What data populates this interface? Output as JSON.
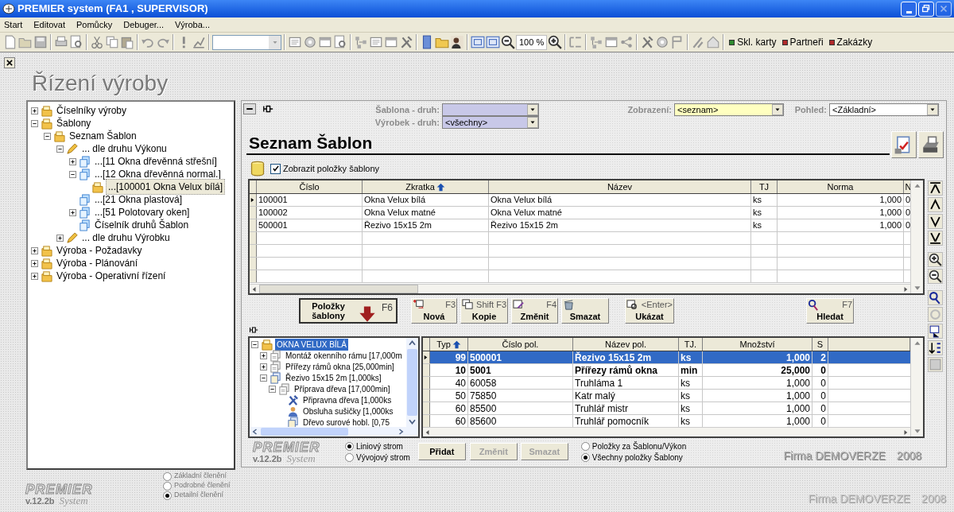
{
  "window": {
    "title": "PREMIER system (FA1 , SUPERVISOR)"
  },
  "menu": [
    "Start",
    "Editovat",
    "Pomůcky",
    "Debuger...",
    "Výroba..."
  ],
  "toolbar": {
    "zoom": "100 %",
    "quick_links": [
      {
        "label": "Skl. karty",
        "color": "#2f8a2f"
      },
      {
        "label": "Partneři",
        "color": "#b02a2a"
      },
      {
        "label": "Zakázky",
        "color": "#b02a2a"
      }
    ]
  },
  "page_title": "Řízení výroby",
  "nav_tree": [
    {
      "label": "Číselníky výroby",
      "kind": "folder",
      "expanded": false,
      "selected": false
    },
    {
      "label": "Šablony",
      "kind": "folder",
      "expanded": true,
      "selected": false,
      "children": [
        {
          "label": "Seznam Šablon",
          "kind": "folder",
          "expanded": true,
          "selected": false,
          "children": [
            {
              "label": "... dle druhu Výkonu",
              "kind": "pencil",
              "expanded": true,
              "selected": false,
              "children": [
                {
                  "label": "...[11 Okna dřevěnná střešní]",
                  "kind": "stack",
                  "expanded": false,
                  "selected": false
                },
                {
                  "label": "...[12 Okna dřevěnná normal.]",
                  "kind": "stack",
                  "expanded": true,
                  "selected": false,
                  "children": [
                    {
                      "label": "...[100001 Okna Velux bílá]",
                      "kind": "folder",
                      "selected": true
                    }
                  ]
                },
                {
                  "label": "...[21 Okna plastová]",
                  "kind": "stack",
                  "selected": false
                },
                {
                  "label": "...[51 Polotovary oken]",
                  "kind": "stack",
                  "expanded": false,
                  "selected": false
                },
                {
                  "label": "Číselník druhů Šablon",
                  "kind": "stack",
                  "selected": false
                }
              ]
            },
            {
              "label": "... dle druhu Výrobku",
              "kind": "pencil",
              "expanded": false,
              "selected": false
            }
          ]
        }
      ]
    },
    {
      "label": "Výroba - Požadavky",
      "kind": "folder",
      "expanded": false,
      "selected": false
    },
    {
      "label": "Výroba - Plánování",
      "kind": "folder",
      "expanded": false,
      "selected": false
    },
    {
      "label": "Výroba - Operativní řízení",
      "kind": "folder",
      "expanded": false,
      "selected": false
    }
  ],
  "filters": [
    {
      "label": "Šablona - druh:"
    },
    {
      "label": "Výrobek - druh:",
      "value": "<všechny>"
    }
  ],
  "display": {
    "label": "Zobrazení:",
    "value": "<seznam>"
  },
  "view": {
    "label": "Pohled:",
    "value": "<Základní>"
  },
  "section_title": "Seznam Šablon",
  "show_items": {
    "label": "Zobrazit položky šablony",
    "checked": true
  },
  "templates_table": {
    "columns": [
      {
        "label": "Číslo"
      },
      {
        "label": "Zkratka",
        "sorted": true
      },
      {
        "label": "Název"
      },
      {
        "label": "TJ"
      },
      {
        "label": "Norma",
        "kind": "number"
      },
      {
        "label": "N"
      }
    ],
    "rows": [
      {
        "selected": true,
        "cells": [
          "100001",
          "Okna Velux bílá",
          "Okna Velux bílá",
          "ks",
          "1,000",
          "0"
        ]
      },
      {
        "selected": false,
        "cells": [
          "100002",
          "Okna Velux matné",
          "Okna Velux matné",
          "ks",
          "1,000",
          "0"
        ]
      },
      {
        "selected": false,
        "cells": [
          "500001",
          "Řezivo 15x15 2m",
          "Řezivo 15x15 2m",
          "ks",
          "1,000",
          "0"
        ]
      }
    ]
  },
  "items_button": {
    "label": "Položky šablony",
    "key": "F6"
  },
  "actions": [
    {
      "label": "Nová",
      "key": "F3",
      "kind": "new"
    },
    {
      "label": "Kopie",
      "key": "Shift F3",
      "kind": "copy"
    },
    {
      "label": "Změnit",
      "key": "F4",
      "kind": "edit"
    },
    {
      "label": "Smazat",
      "kind": "delete"
    },
    {
      "label": "Ukázat",
      "key": "<Enter>",
      "kind": "show"
    },
    {
      "label": "Hledat",
      "key": "F7",
      "kind": "find"
    }
  ],
  "item_tree": [
    {
      "label": "OKNA VELUX BÍLÁ",
      "kind": "folder",
      "expanded": true,
      "selected": true,
      "children": [
        {
          "label": "Montáž okenního rámu [17,000m",
          "kind": "operation",
          "expanded": false,
          "selected": false
        },
        {
          "label": "Přířezy rámů okna [25,000min]",
          "kind": "operation",
          "expanded": false,
          "selected": false
        },
        {
          "label": "Řezivo 15x15 2m [1,000ks]",
          "kind": "material",
          "expanded": true,
          "selected": false,
          "children": [
            {
              "label": "Příprava dřeva [17,000min]",
              "kind": "operation",
              "expanded": true,
              "selected": false,
              "children": [
                {
                  "label": "Připravna dřeva [1,000ks",
                  "kind": "tool",
                  "selected": false
                },
                {
                  "label": "Obsluha sušičky [1,000ks",
                  "kind": "person",
                  "selected": false
                },
                {
                  "label": "Dřevo surové hobl. [0,75",
                  "kind": "material",
                  "selected": false
                }
              ]
            }
          ]
        }
      ]
    }
  ],
  "items_table": {
    "columns": [
      {
        "label": "Typ",
        "sorted": true,
        "kind": "number"
      },
      {
        "label": "Číslo pol."
      },
      {
        "label": "Název pol."
      },
      {
        "label": "TJ."
      },
      {
        "label": "Množství",
        "kind": "number"
      },
      {
        "label": "S",
        "kind": "number"
      }
    ],
    "rows": [
      {
        "selected": true,
        "bold": true,
        "cells": [
          "99",
          "500001",
          "Řezivo 15x15 2m",
          "ks",
          "1,000",
          "2"
        ]
      },
      {
        "selected": false,
        "bold": true,
        "cells": [
          "10",
          "5001",
          "Přířezy rámů okna",
          "min",
          "25,000",
          "0"
        ]
      },
      {
        "selected": false,
        "bold": false,
        "cells": [
          "40",
          "60058",
          "Truhláma 1",
          "ks",
          "1,000",
          "0"
        ]
      },
      {
        "selected": false,
        "bold": false,
        "cells": [
          "50",
          "75850",
          "Katr malý",
          "ks",
          "1,000",
          "0"
        ]
      },
      {
        "selected": false,
        "bold": false,
        "cells": [
          "60",
          "85500",
          "Truhlář mistr",
          "ks",
          "1,000",
          "0"
        ]
      },
      {
        "selected": false,
        "bold": false,
        "cells": [
          "60",
          "85600",
          "Truhlář pomocník",
          "ks",
          "1,000",
          "0"
        ]
      }
    ]
  },
  "panel_logo": {
    "name": "PREMIER",
    "script": "System",
    "version": "v.12.2b"
  },
  "tree_style": [
    {
      "label": "Liniový strom",
      "selected": true
    },
    {
      "label": "Vývojový strom",
      "selected": false
    }
  ],
  "item_buttons": [
    {
      "label": "Přidat",
      "disabled": false
    },
    {
      "label": "Změnit",
      "disabled": true
    },
    {
      "label": "Smazat",
      "disabled": true
    }
  ],
  "item_scope": [
    {
      "label": "Položky za Šablonu/Výkon",
      "selected": false
    },
    {
      "label": "Všechny položky Šablony",
      "selected": true
    }
  ],
  "panel_footer": {
    "company": "Firma DEMOVERZE",
    "year": "2008"
  },
  "app_logo": {
    "name": "PREMIER",
    "script": "System",
    "version": "v.12.2b"
  },
  "detail_level": [
    {
      "label": "Základní členění",
      "selected": false
    },
    {
      "label": "Podrobné členění",
      "selected": false
    },
    {
      "label": "Detailní členění",
      "selected": true
    }
  ],
  "footer": {
    "company": "Firma DEMOVERZE",
    "year": "2008"
  }
}
